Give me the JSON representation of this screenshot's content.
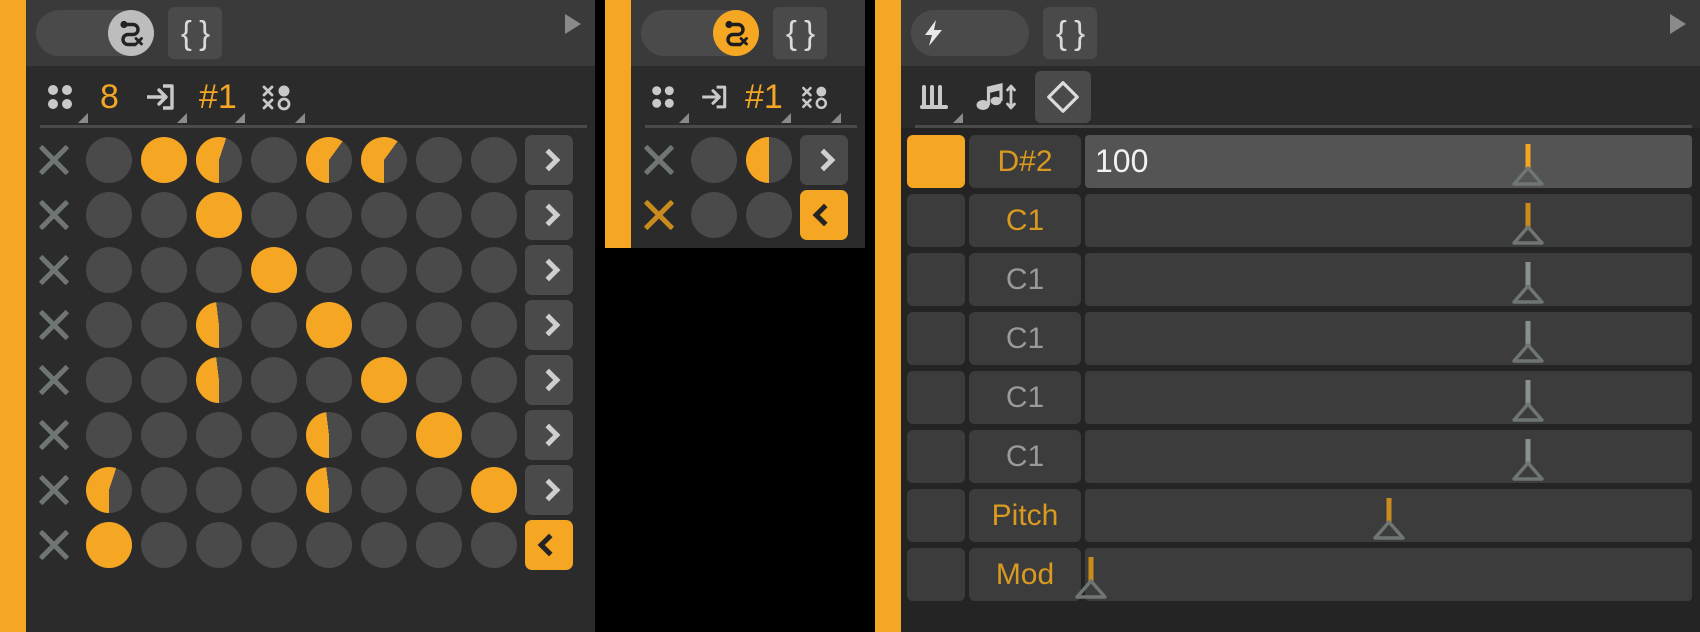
{
  "theme": {
    "accent": "#F5A623",
    "accent_dim": "#C98B1C",
    "panel_bg": "#2b2b2b",
    "title_bg": "#3a3a3a",
    "cell_off": "#4a4a4a",
    "text_dim": "#9a9a9a"
  },
  "panels": [
    {
      "id": "sequencer-main",
      "titlebar": {
        "toggle_state": "off",
        "toggle_icon": "snake-route-x-icon",
        "brace_label": "{ }",
        "play_icon": "play-triangle-icon"
      },
      "toolbar": {
        "items": [
          {
            "name": "grid-dots-icon",
            "type": "icon",
            "label": ""
          },
          {
            "name": "step-count",
            "type": "value",
            "label": "8"
          },
          {
            "name": "enter-box-icon",
            "type": "icon",
            "label": ""
          },
          {
            "name": "pattern-number",
            "type": "value",
            "label": "#1"
          },
          {
            "name": "scatter-icon",
            "type": "icon",
            "label": ""
          }
        ]
      },
      "grid": {
        "columns": 8,
        "row_arrow": [
          ">",
          ">",
          ">",
          ">",
          ">",
          ">",
          ">",
          "<"
        ],
        "row_arrow_highlight": [
          false,
          false,
          false,
          false,
          false,
          false,
          false,
          true
        ],
        "mute_active": [
          false,
          false,
          false,
          false,
          false,
          false,
          false,
          false
        ],
        "cells": [
          [
            0,
            100,
            55,
            0,
            60,
            60,
            0,
            0
          ],
          [
            0,
            0,
            100,
            0,
            0,
            0,
            0,
            0
          ],
          [
            0,
            0,
            0,
            100,
            0,
            0,
            0,
            0
          ],
          [
            0,
            0,
            48,
            0,
            100,
            0,
            0,
            0
          ],
          [
            0,
            0,
            48,
            0,
            0,
            100,
            0,
            0
          ],
          [
            0,
            0,
            0,
            0,
            48,
            0,
            100,
            0
          ],
          [
            55,
            0,
            0,
            0,
            48,
            0,
            0,
            100
          ],
          [
            100,
            0,
            0,
            0,
            0,
            0,
            0,
            0
          ]
        ]
      }
    },
    {
      "id": "sequencer-secondary",
      "titlebar": {
        "toggle_state": "on",
        "toggle_icon": "snake-route-x-icon",
        "brace_label": "{ }",
        "play_icon": "play-triangle-icon"
      },
      "toolbar": {
        "items": [
          {
            "name": "grid-dots-icon",
            "type": "icon",
            "label": ""
          },
          {
            "name": "enter-box-icon",
            "type": "icon",
            "label": ""
          },
          {
            "name": "pattern-number",
            "type": "value",
            "label": "#1"
          },
          {
            "name": "scatter-icon",
            "type": "icon",
            "label": ""
          }
        ]
      },
      "grid": {
        "columns": 2,
        "row_arrow": [
          ">",
          "<"
        ],
        "row_arrow_highlight": [
          false,
          true
        ],
        "mute_active": [
          false,
          true
        ],
        "cells": [
          [
            0,
            50
          ],
          [
            0,
            0
          ]
        ]
      }
    }
  ],
  "note_panel": {
    "id": "note-editor",
    "titlebar": {
      "toggle_state": "left",
      "toggle_icon": "lightning-bolt-icon",
      "brace_label": "{ }",
      "play_icon": "play-triangle-icon"
    },
    "toolbar": {
      "items": [
        {
          "name": "faders-icon",
          "type": "icon",
          "label": ""
        },
        {
          "name": "note-updown-icon",
          "type": "icon",
          "label": ""
        },
        {
          "name": "diamond-icon",
          "type": "icon",
          "label": "",
          "boxed": true
        }
      ]
    },
    "rows": [
      {
        "enabled": true,
        "name": "D#2",
        "name_style": "accent",
        "value": "100",
        "selected": true,
        "marker_pct": 73,
        "marker_color": "hot"
      },
      {
        "enabled": false,
        "name": "C1",
        "name_style": "accent",
        "value": "",
        "selected": false,
        "marker_pct": 73,
        "marker_color": "warm"
      },
      {
        "enabled": false,
        "name": "C1",
        "name_style": "dim",
        "value": "",
        "selected": false,
        "marker_pct": 73,
        "marker_color": "gray"
      },
      {
        "enabled": false,
        "name": "C1",
        "name_style": "dim",
        "value": "",
        "selected": false,
        "marker_pct": 73,
        "marker_color": "gray"
      },
      {
        "enabled": false,
        "name": "C1",
        "name_style": "dim",
        "value": "",
        "selected": false,
        "marker_pct": 73,
        "marker_color": "gray"
      },
      {
        "enabled": false,
        "name": "C1",
        "name_style": "dim",
        "value": "",
        "selected": false,
        "marker_pct": 73,
        "marker_color": "gray"
      },
      {
        "enabled": false,
        "name": "Pitch",
        "name_style": "accent",
        "value": "",
        "selected": false,
        "marker_pct": 50,
        "marker_color": "warm"
      },
      {
        "enabled": false,
        "name": "Mod",
        "name_style": "accent",
        "value": "",
        "selected": false,
        "marker_pct": 1,
        "marker_color": "warm"
      }
    ]
  }
}
